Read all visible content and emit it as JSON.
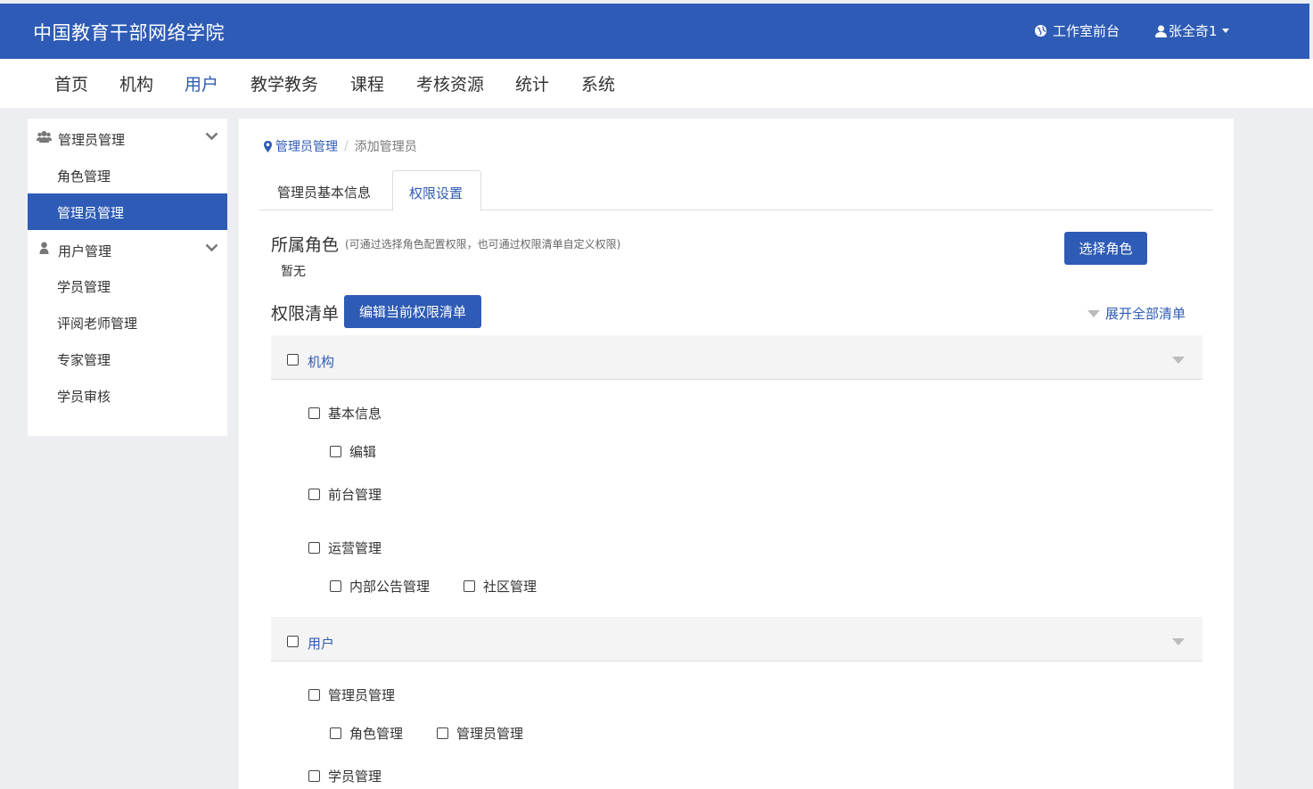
{
  "header": {
    "site_title": "中国教育干部网络学院",
    "front_link": "工作室前台",
    "user_name": "张全奇1"
  },
  "nav": {
    "items": [
      "首页",
      "机构",
      "用户",
      "教学教务",
      "课程",
      "考核资源",
      "统计",
      "系统"
    ],
    "active": "用户"
  },
  "sidebar": {
    "groups": [
      {
        "label": "管理员管理",
        "icon": "users-icon",
        "items": [
          "角色管理",
          "管理员管理"
        ]
      },
      {
        "label": "用户管理",
        "icon": "user-icon",
        "items": [
          "学员管理",
          "评阅老师管理",
          "专家管理",
          "学员审核"
        ]
      }
    ],
    "active_item": "管理员管理"
  },
  "breadcrumb": {
    "parent": "管理员管理",
    "current": "添加管理员"
  },
  "tabs": {
    "items": [
      "管理员基本信息",
      "权限设置"
    ],
    "active": "权限设置"
  },
  "role": {
    "title": "所属角色",
    "hint": "(可通过选择角色配置权限，也可通过权限清单自定义权限)",
    "value": "暂无",
    "select_button": "选择角色"
  },
  "permissions": {
    "title": "权限清单",
    "edit_button": "编辑当前权限清单",
    "expand_all": "展开全部清单",
    "sections": [
      {
        "label": "机构",
        "groups": [
          {
            "label": "基本信息",
            "children": [
              "编辑"
            ]
          },
          {
            "label": "前台管理",
            "children": []
          },
          {
            "label": "运营管理",
            "children": [
              "内部公告管理",
              "社区管理"
            ]
          }
        ]
      },
      {
        "label": "用户",
        "groups": [
          {
            "label": "管理员管理",
            "children": [
              "角色管理",
              "管理员管理"
            ]
          },
          {
            "label": "学员管理",
            "children": []
          }
        ]
      }
    ]
  },
  "colors": {
    "primary": "#2e5bb5",
    "background": "#eceef1",
    "section_header": "#f4f4f4"
  }
}
